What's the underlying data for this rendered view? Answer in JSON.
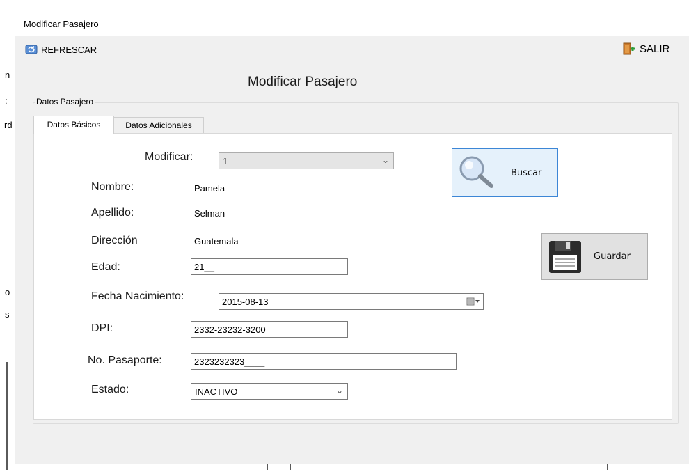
{
  "window": {
    "title": "Modificar Pasajero"
  },
  "toolbar": {
    "refresh_label": "REFRESCAR",
    "exit_label": "SALIR"
  },
  "form": {
    "title": "Modificar Pasajero",
    "group_label": "Datos Pasajero",
    "tabs": [
      "Datos Básicos",
      "Datos Adicionales"
    ],
    "fields": {
      "modificar": {
        "label": "Modificar:",
        "value": "1"
      },
      "nombre": {
        "label": "Nombre:",
        "value": "Pamela"
      },
      "apellido": {
        "label": "Apellido:",
        "value": "Selman"
      },
      "direccion": {
        "label": "Dirección",
        "value": "Guatemala"
      },
      "edad": {
        "label": "Edad:",
        "value": "21__"
      },
      "fecha": {
        "label": "Fecha  Nacimiento:",
        "value": "2015-08-13"
      },
      "dpi": {
        "label": "DPI:",
        "value": "2332-23232-3200"
      },
      "pasaporte": {
        "label": "No. Pasaporte:",
        "value": "2323232323____"
      },
      "estado": {
        "label": "Estado:",
        "value": "INACTIVO"
      }
    },
    "buttons": {
      "buscar": "Buscar",
      "guardar": "Guardar"
    }
  },
  "background_fragments": [
    "n",
    ":",
    "rd",
    "o",
    "s"
  ],
  "colors": {
    "accent": "#3c86d6",
    "button_hover_bg": "#e5f1fb",
    "window_bg": "#f0f0f0"
  }
}
